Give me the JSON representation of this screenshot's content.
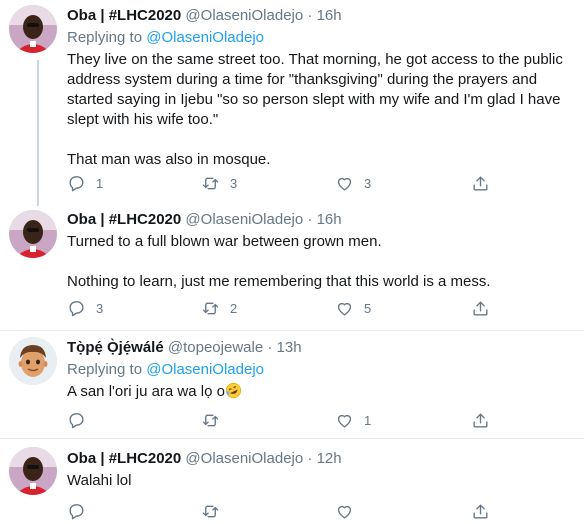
{
  "tweets": [
    {
      "name": "Oba | #LHC2020",
      "handle": "@OlaseniOladejo",
      "sep": "·",
      "time": "16h",
      "replying_prefix": "Replying to",
      "replying_to": "@OlaseniOladejo",
      "text": "They live on the same street too. That morning, he got access to the public address system during a time for \"thanksgiving\" during the prayers and started saying in Ijebu \"so so person slept with my wife and I'm glad I have slept with his wife too.\"\n\nThat man was also in mosque.",
      "reply_count": "1",
      "retweet_count": "3",
      "like_count": "3"
    },
    {
      "name": "Oba | #LHC2020",
      "handle": "@OlaseniOladejo",
      "sep": "·",
      "time": "16h",
      "text": "Turned to a full blown war between grown men.\n\nNothing to learn, just me remembering that this world is a mess.",
      "reply_count": "3",
      "retweet_count": "2",
      "like_count": "5"
    },
    {
      "name": "Tọ̀pẹ́ Ọ̀jẹ́wálé",
      "handle": "@topeojewale",
      "sep": "·",
      "time": "13h",
      "replying_prefix": "Replying to",
      "replying_to": "@OlaseniOladejo",
      "text": "A san l'ori ju ara wa lọ o",
      "reply_count": "",
      "retweet_count": "",
      "like_count": "1"
    },
    {
      "name": "Oba | #LHC2020",
      "handle": "@OlaseniOladejo",
      "sep": "·",
      "time": "12h",
      "text": "Walahi lol",
      "reply_count": "",
      "retweet_count": "",
      "like_count": ""
    }
  ],
  "icons": {
    "reply": "reply-icon",
    "retweet": "retweet-icon",
    "like": "heart-icon",
    "share": "share-icon",
    "emoji": "rolling-on-floor-laughing-emoji"
  },
  "colors": {
    "link": "#1da1f2",
    "muted": "#657786",
    "separator": "#e6ecf0",
    "thread_line": "#ccd6dd"
  }
}
